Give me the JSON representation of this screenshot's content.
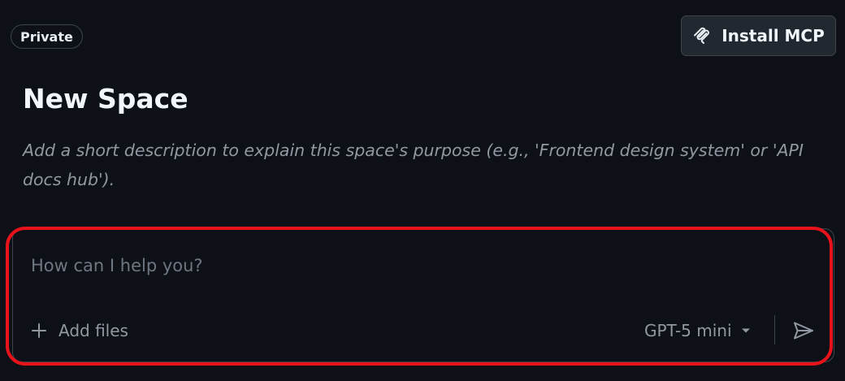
{
  "header": {
    "visibility_badge": "Private",
    "install_button_label": "Install MCP",
    "install_button_icon": "mcp-icon"
  },
  "space": {
    "title": "New Space",
    "description_placeholder": "Add a short description to explain this space's purpose (e.g., 'Frontend design system' or 'API docs hub')."
  },
  "composer": {
    "prompt_placeholder": "How can I help you?",
    "prompt_value": "",
    "add_files_label": "Add files",
    "add_files_icon": "plus-icon",
    "model_label": "GPT-5 mini",
    "model_icon": "chevron-down-icon",
    "send_icon": "send-icon"
  },
  "colors": {
    "background": "#0d1117",
    "highlight_annotation": "#e8121a",
    "muted_text": "#9198a1"
  }
}
